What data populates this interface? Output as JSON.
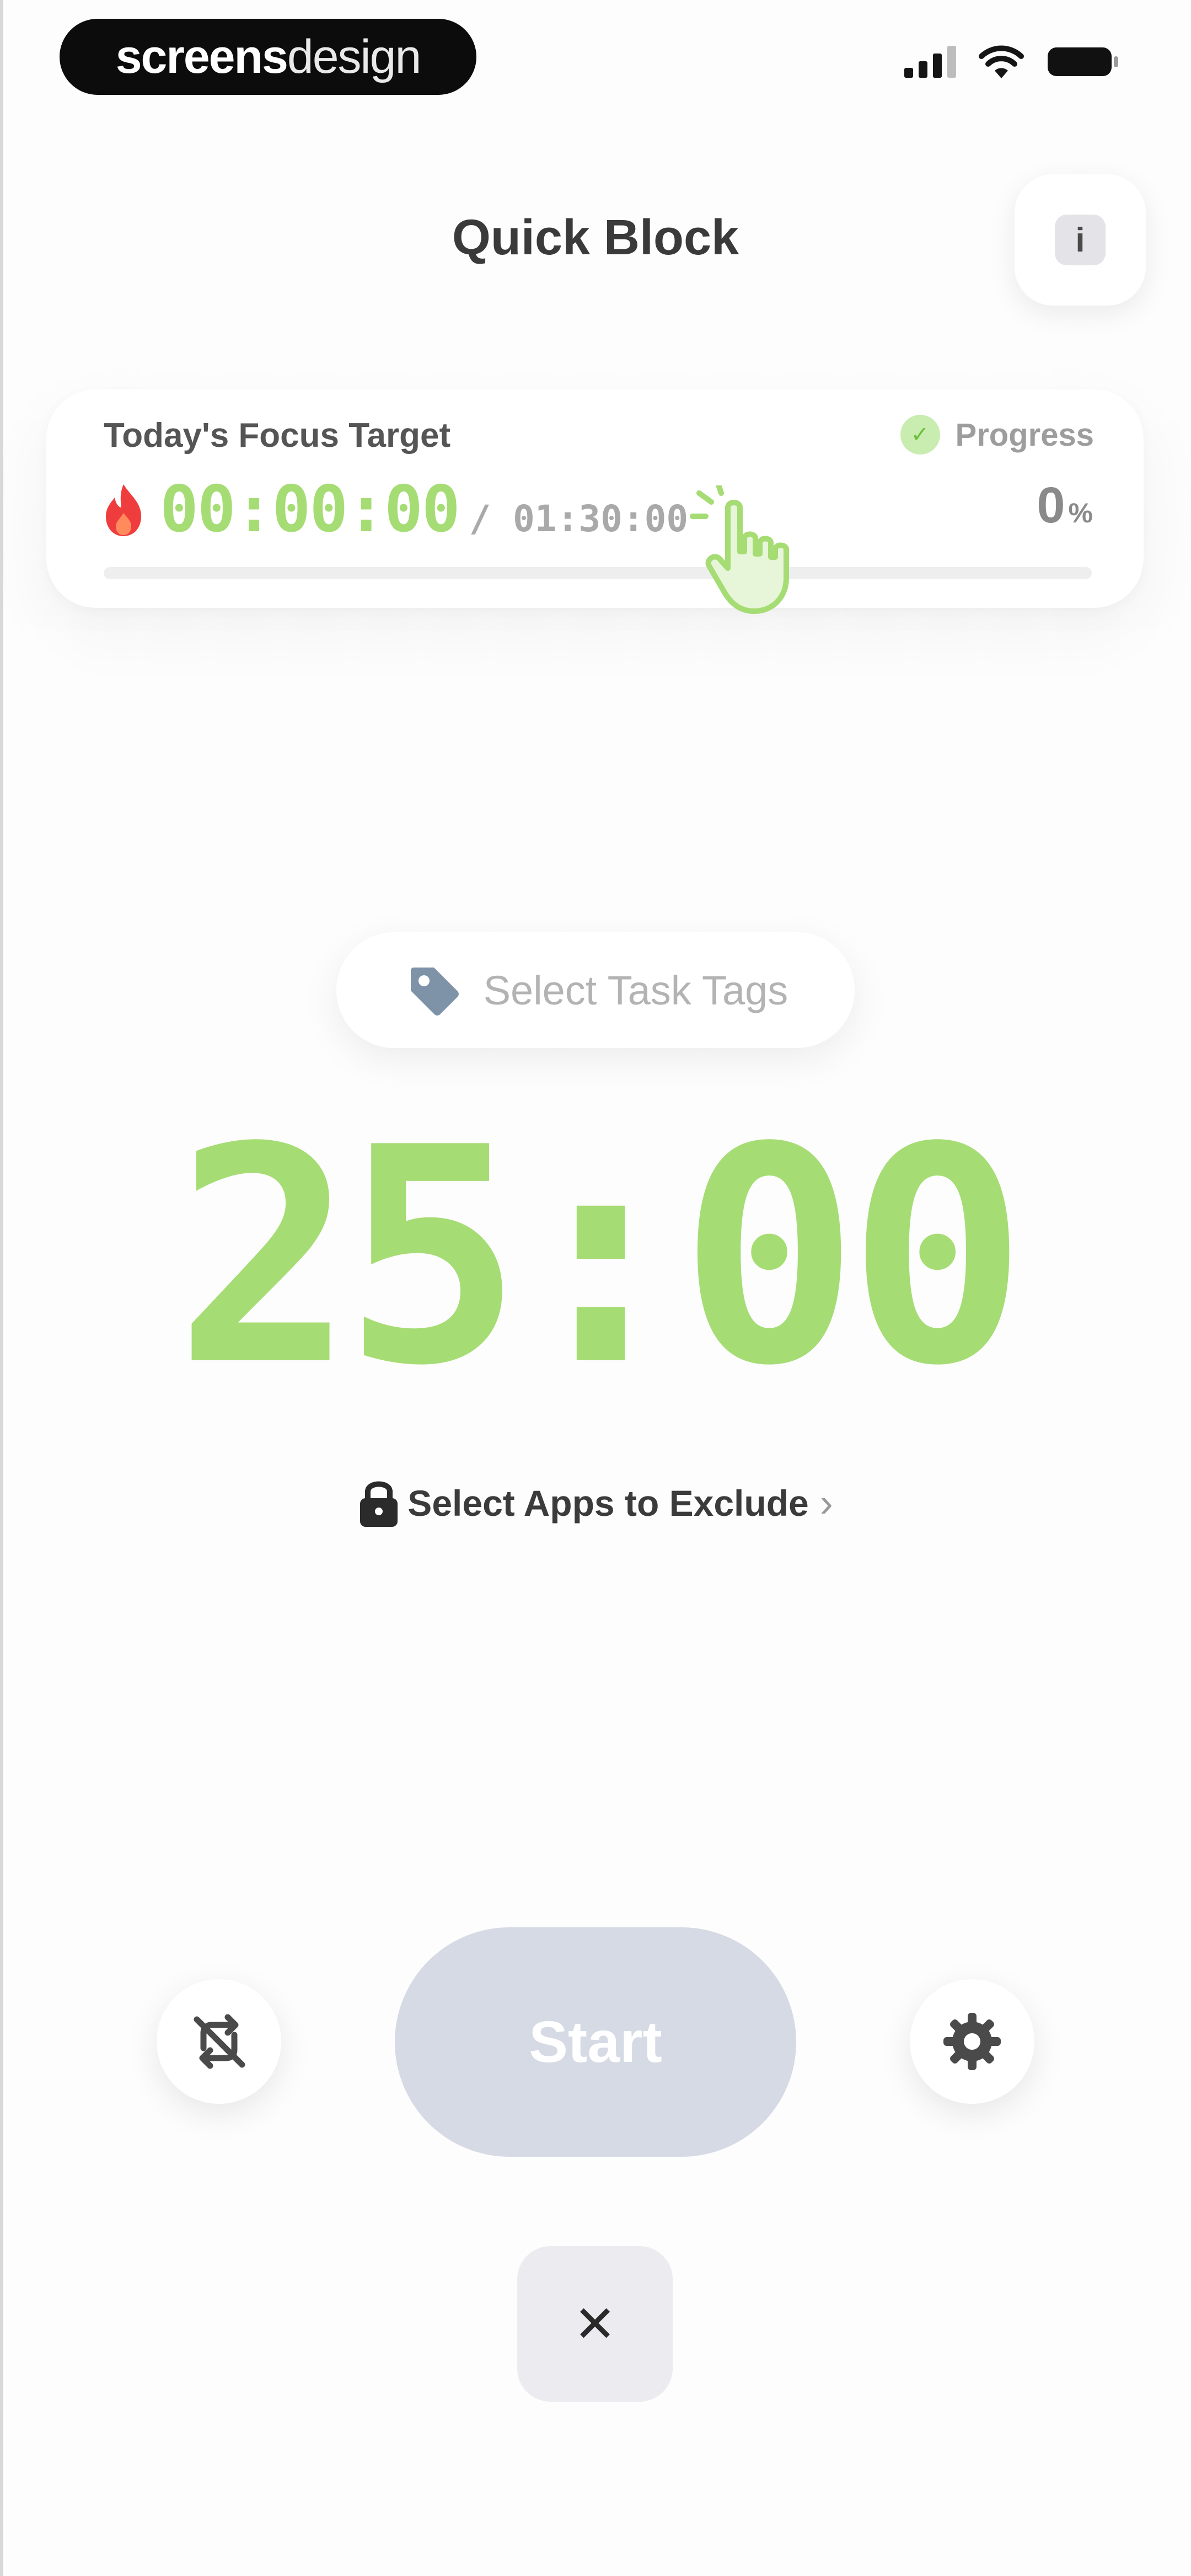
{
  "status_bar": {
    "brand_bold": "screens",
    "brand_light": "design"
  },
  "header": {
    "title": "Quick Block",
    "info_glyph": "i"
  },
  "focus_card": {
    "label": "Today's Focus Target",
    "progress_label": "Progress",
    "elapsed": "00:00:00",
    "target": "/ 01:30:00",
    "percent_value": "0",
    "percent_sign": "%",
    "progress_fraction": 0
  },
  "tags": {
    "label": "Select Task Tags"
  },
  "timer": {
    "display": "25:00"
  },
  "exclude": {
    "label": "Select Apps to Exclude"
  },
  "controls": {
    "start_label": "Start",
    "close_glyph": "✕"
  },
  "icons": {
    "flame": "flame-icon",
    "check": "check-icon",
    "hand": "hand-pointer-icon",
    "tag": "tag-icon",
    "lock": "lock-icon",
    "chevron": "chevron-right-icon",
    "no_repeat": "no-repeat-icon",
    "settings": "gear-icon",
    "close": "close-icon"
  },
  "colors": {
    "accent_green": "#a6dc74",
    "start_disabled": "#d5dae4",
    "flame_red": "#ef3d3d"
  }
}
